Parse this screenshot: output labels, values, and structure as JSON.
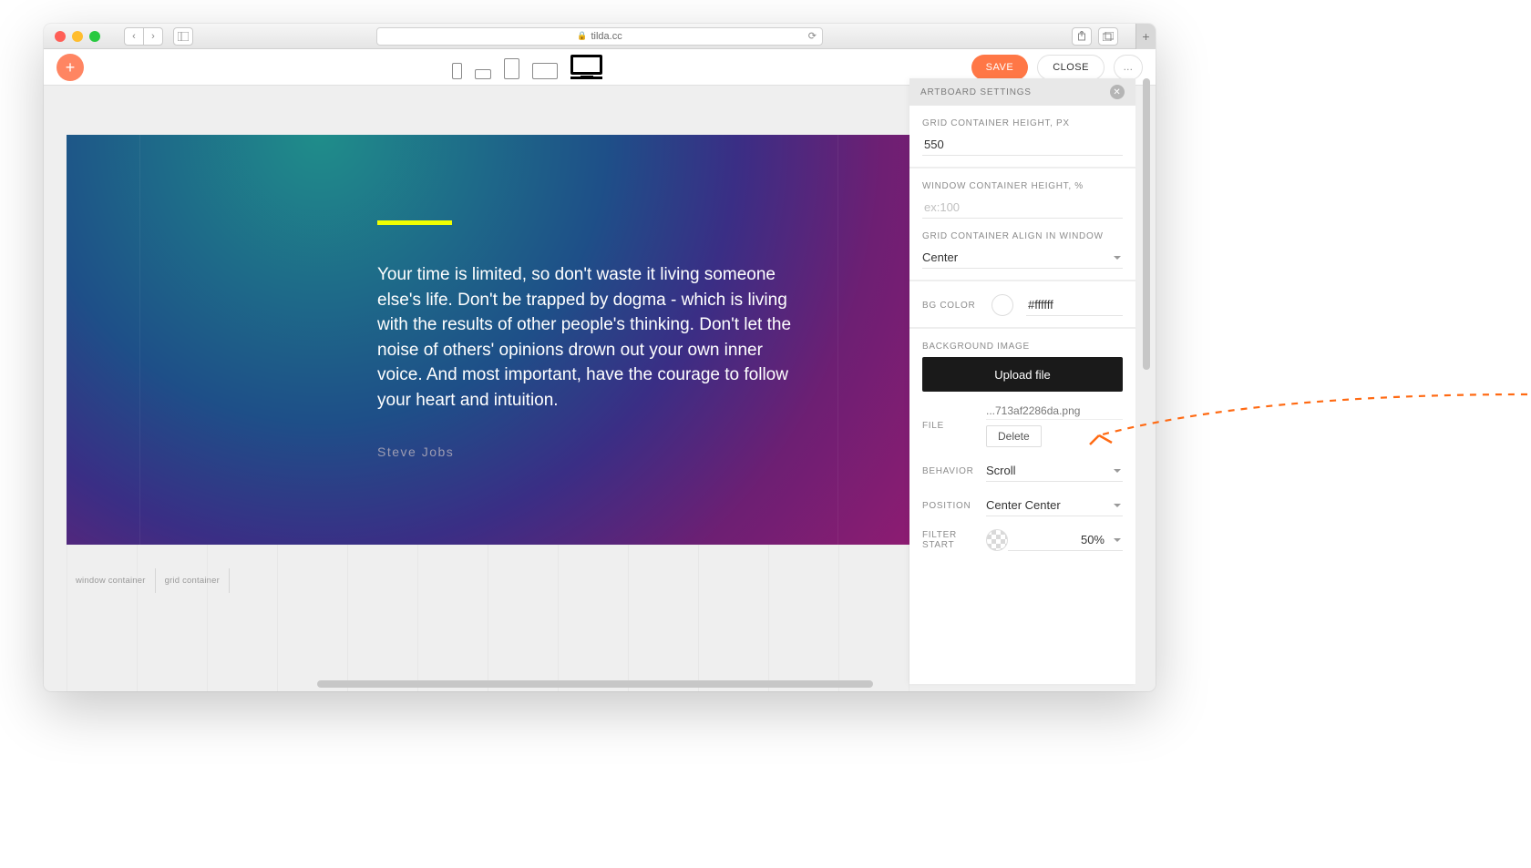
{
  "browser": {
    "url": "tilda.cc"
  },
  "toolbar": {
    "save": "SAVE",
    "close": "CLOSE",
    "more": "…"
  },
  "canvas": {
    "quote": "Your time is limited, so don't waste it living someone else's life. Don't be trapped by dogma - which is living with the results of other people's thinking. Don't let the noise of others' opinions drown out your own inner voice. And most important, have the courage to follow your heart and intuition.",
    "author": "Steve Jobs",
    "tabs": {
      "window": "window container",
      "grid": "grid container"
    }
  },
  "panel": {
    "title": "ARTBOARD SETTINGS",
    "gridHeightLabel": "GRID CONTAINER HEIGHT, PX",
    "gridHeightValue": "550",
    "windowHeightLabel": "WINDOW CONTAINER HEIGHT, %",
    "windowHeightPlaceholder": "ex:100",
    "alignLabel": "GRID CONTAINER ALIGN IN WINDOW",
    "alignValue": "Center",
    "bgColorLabel": "BG COLOR",
    "bgColorValue": "#ffffff",
    "bgImageLabel": "BACKGROUND IMAGE",
    "uploadLabel": "Upload file",
    "fileLabel": "FILE",
    "fileName": "...713af2286da.png",
    "deleteLabel": "Delete",
    "behaviorLabel": "BEHAVIOR",
    "behaviorValue": "Scroll",
    "positionLabel": "POSITION",
    "positionValue": "Center Center",
    "filterStartLabel": "FILTER START",
    "filterStartValue": "50%"
  }
}
